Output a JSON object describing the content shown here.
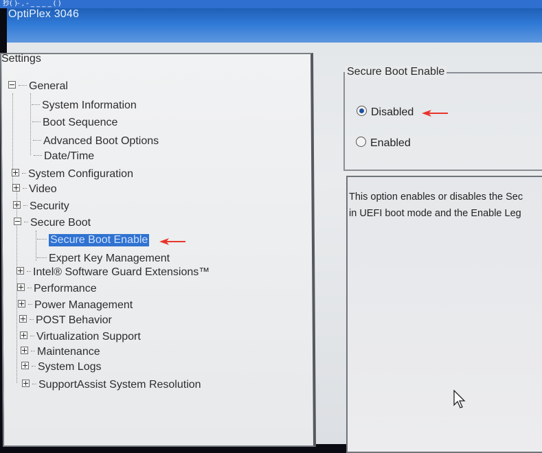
{
  "window": {
    "top_text": "抄(  )-  ,  -   _ _ _ _  (  )",
    "title": "OptiPlex 3046"
  },
  "tree": {
    "header": "Settings",
    "items": [
      {
        "label": "General",
        "level": 0,
        "expander": "minus"
      },
      {
        "label": "System Information",
        "level": 1
      },
      {
        "label": "Boot Sequence",
        "level": 1
      },
      {
        "label": "Advanced Boot Options",
        "level": 1
      },
      {
        "label": "Date/Time",
        "level": 1
      },
      {
        "label": "System Configuration",
        "level": 0,
        "expander": "plus"
      },
      {
        "label": "Video",
        "level": 0,
        "expander": "plus"
      },
      {
        "label": "Security",
        "level": 0,
        "expander": "plus"
      },
      {
        "label": "Secure Boot",
        "level": 0,
        "expander": "minus"
      },
      {
        "label": "Secure Boot Enable",
        "level": 1,
        "selected": true
      },
      {
        "label": "Expert Key Management",
        "level": 1
      },
      {
        "label": "Intel® Software Guard Extensions™",
        "level": 0,
        "expander": "plus"
      },
      {
        "label": "Performance",
        "level": 0,
        "expander": "plus"
      },
      {
        "label": "Power Management",
        "level": 0,
        "expander": "plus"
      },
      {
        "label": "POST Behavior",
        "level": 0,
        "expander": "plus"
      },
      {
        "label": "Virtualization Support",
        "level": 0,
        "expander": "plus"
      },
      {
        "label": "Maintenance",
        "level": 0,
        "expander": "plus"
      },
      {
        "label": "System Logs",
        "level": 0,
        "expander": "plus"
      },
      {
        "label": "SupportAssist System Resolution",
        "level": 0,
        "expander": "plus"
      }
    ]
  },
  "option_group": {
    "title": "Secure Boot Enable",
    "options": [
      {
        "label": "Disabled",
        "selected": true
      },
      {
        "label": "Enabled",
        "selected": false
      }
    ]
  },
  "description": "This option enables or disables the Sec\nin UEFI boot mode and the Enable Leg",
  "colors": {
    "selection": "#2f72d0",
    "annotation_arrow": "#e8352b",
    "title_bar": "#2f79d6"
  },
  "icons": {
    "annotation": "red-arrow-icon",
    "cursor": "mouse-pointer-icon"
  }
}
